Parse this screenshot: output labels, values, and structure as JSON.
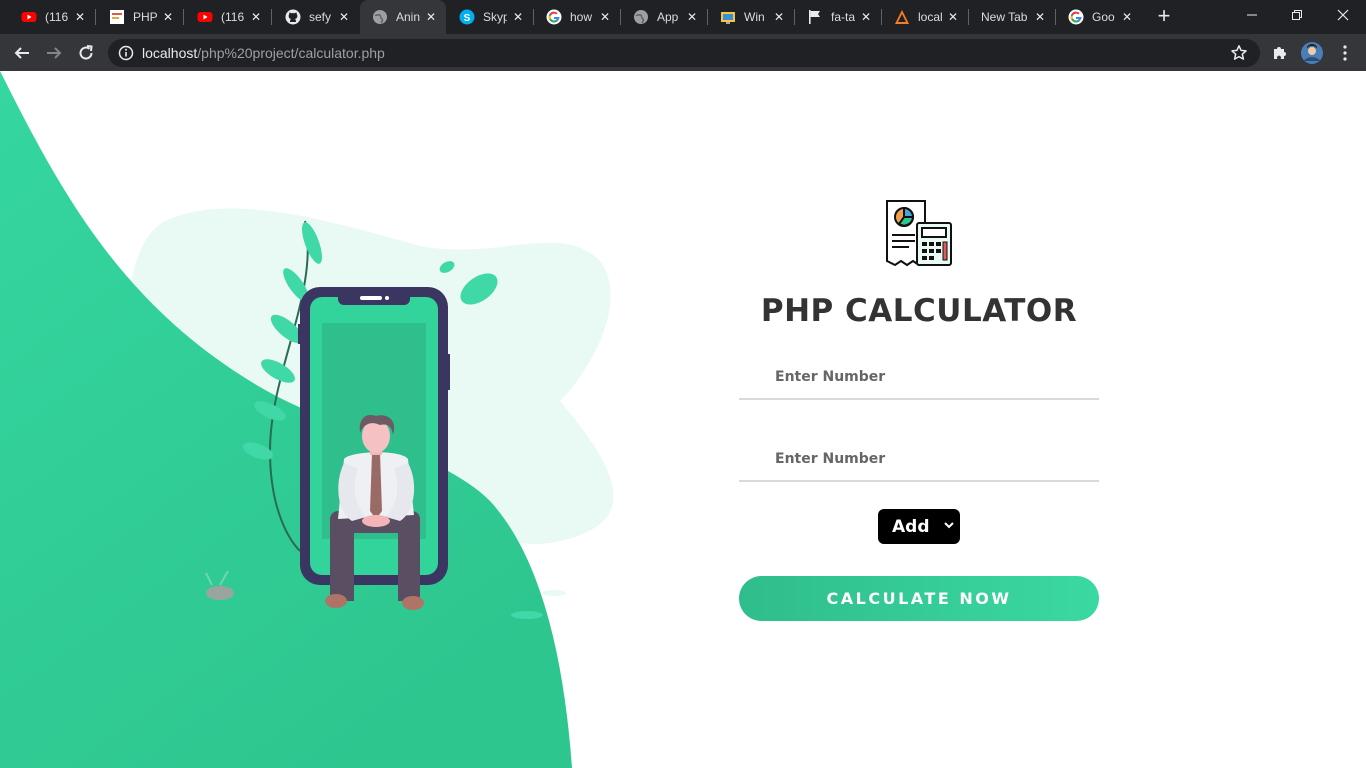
{
  "browser": {
    "tabs": [
      {
        "title": "(116",
        "icon": "youtube-icon"
      },
      {
        "title": "PHP",
        "icon": "php-site-icon"
      },
      {
        "title": "(116",
        "icon": "youtube-icon"
      },
      {
        "title": "sefy",
        "icon": "github-icon"
      },
      {
        "title": "Anin",
        "icon": "globe-icon"
      },
      {
        "title": "Skyp",
        "icon": "skype-icon"
      },
      {
        "title": "how",
        "icon": "google-icon"
      },
      {
        "title": "App",
        "icon": "globe-icon"
      },
      {
        "title": "Win",
        "icon": "windows-folder-icon"
      },
      {
        "title": "fa-ta",
        "icon": "flag-icon"
      },
      {
        "title": "local",
        "icon": "xampp-icon"
      },
      {
        "title": "New Tab",
        "icon": ""
      },
      {
        "title": "Goo",
        "icon": "google-icon"
      }
    ],
    "active_tab_index": 4,
    "url_host": "localhost",
    "url_path": "/php%20project/calculator.php"
  },
  "page": {
    "title": "PHP CALCULATOR",
    "input1": {
      "placeholder": "Enter Number",
      "value": ""
    },
    "input2": {
      "placeholder": "Enter Number",
      "value": ""
    },
    "operation": {
      "selected": "Add"
    },
    "submit_label": "CALCULATE NOW",
    "colors": {
      "accent": "#33d49c",
      "title": "#333333",
      "select_bg": "#000000"
    }
  }
}
